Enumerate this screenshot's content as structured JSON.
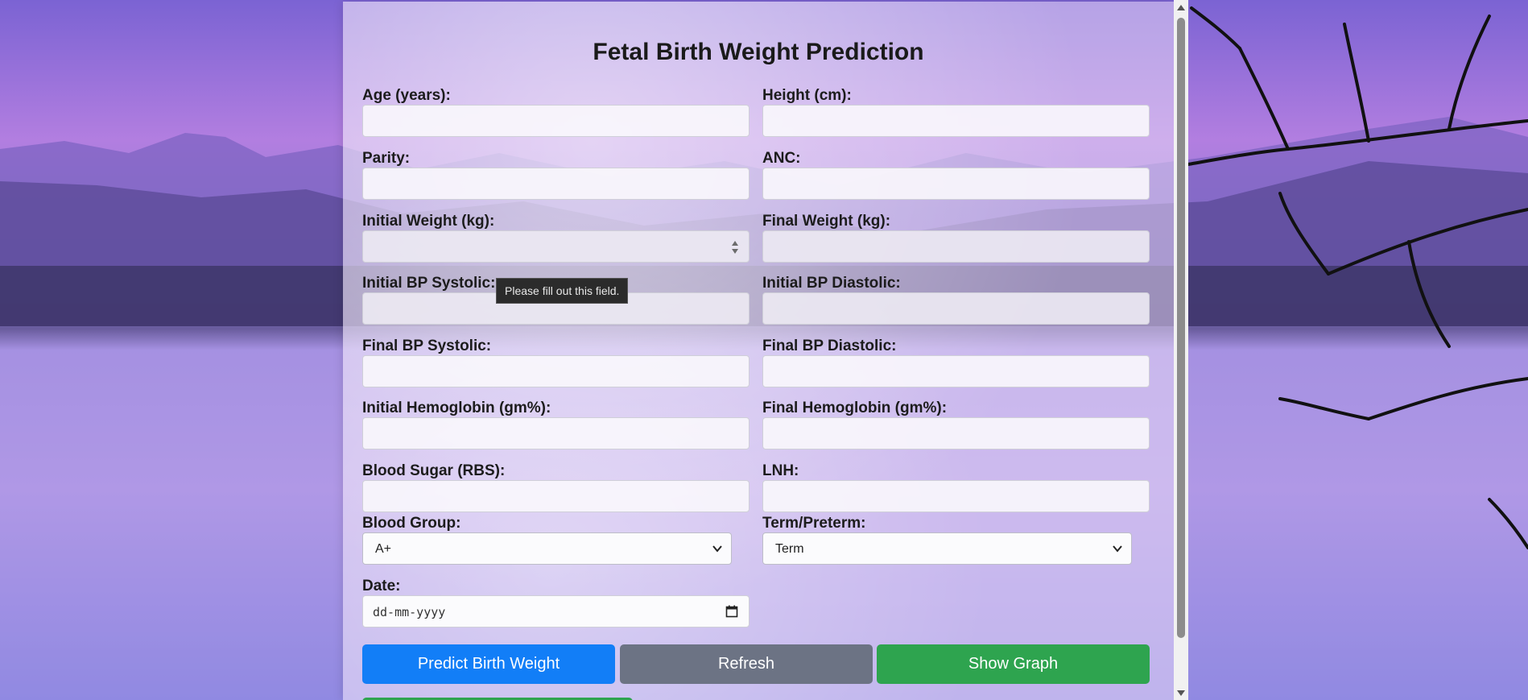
{
  "title": "Fetal Birth Weight Prediction",
  "fields": [
    {
      "label": "Age (years):",
      "value": ""
    },
    {
      "label": "Height (cm):",
      "value": ""
    },
    {
      "label": "Parity:",
      "value": ""
    },
    {
      "label": "ANC:",
      "value": ""
    },
    {
      "label": "Initial Weight (kg):",
      "value": ""
    },
    {
      "label": "Final Weight (kg):",
      "value": ""
    },
    {
      "label": "Initial BP Systolic:",
      "value": ""
    },
    {
      "label": "Initial BP Diastolic:",
      "value": ""
    },
    {
      "label": "Final BP Systolic:",
      "value": ""
    },
    {
      "label": "Final BP Diastolic:",
      "value": ""
    },
    {
      "label": "Initial Hemoglobin (gm%):",
      "value": ""
    },
    {
      "label": "Final Hemoglobin (gm%):",
      "value": ""
    },
    {
      "label": "Blood Sugar (RBS):",
      "value": ""
    },
    {
      "label": "LNH:",
      "value": ""
    }
  ],
  "selects": {
    "blood_group": {
      "label": "Blood Group:",
      "selected": "A+"
    },
    "term": {
      "label": "Term/Preterm:",
      "selected": "Term"
    }
  },
  "date": {
    "label": "Date:",
    "placeholder": "dd-mm-yyyy"
  },
  "tooltip": "Please fill out this field.",
  "buttons": {
    "predict": "Predict Birth Weight",
    "refresh": "Refresh",
    "graph": "Show Graph"
  },
  "colors": {
    "primary": "#127ef7",
    "secondary": "#6c7384",
    "success": "#2ea44f"
  }
}
